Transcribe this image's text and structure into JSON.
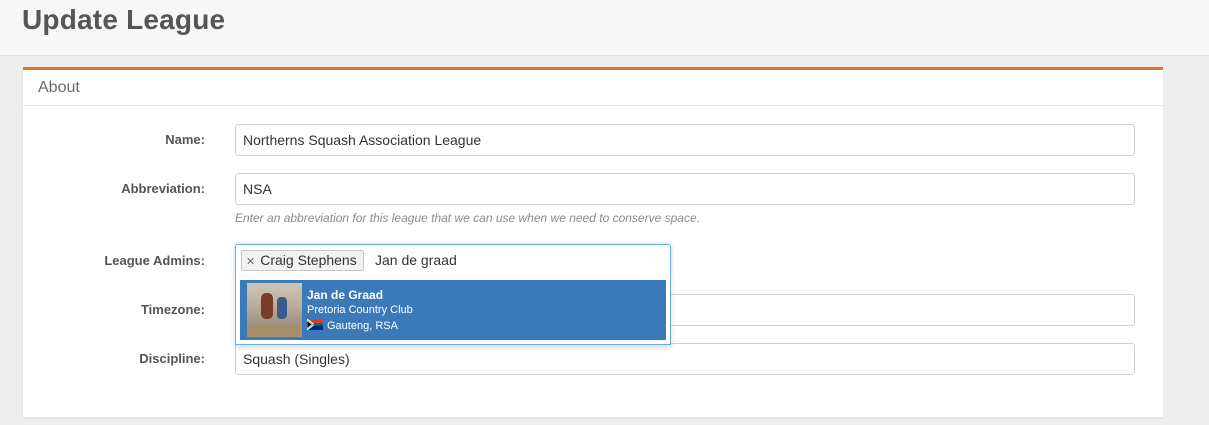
{
  "page": {
    "title": "Update League"
  },
  "panel": {
    "header": "About"
  },
  "form": {
    "name": {
      "label": "Name:",
      "value": "Northerns Squash Association League"
    },
    "abbreviation": {
      "label": "Abbreviation:",
      "value": "NSA",
      "help": "Enter an abbreviation for this league that we can use when we need to conserve space."
    },
    "league_admins": {
      "label": "League Admins:",
      "selected": [
        {
          "name": "Craig Stephens",
          "remove_icon": "close-icon"
        }
      ],
      "typed": "Jan de graad",
      "suggestions": [
        {
          "name": "Jan de Graad",
          "club": "Pretoria Country Club",
          "location": "Gauteng, RSA",
          "flag_icon": "south-africa-flag-icon"
        }
      ]
    },
    "timezone": {
      "label": "Timezone:"
    },
    "discipline": {
      "label": "Discipline:",
      "value": "Squash (Singles)"
    }
  },
  "colors": {
    "accent": "#e0722c",
    "highlight": "#3a7ab8",
    "focus": "#66afe9"
  }
}
